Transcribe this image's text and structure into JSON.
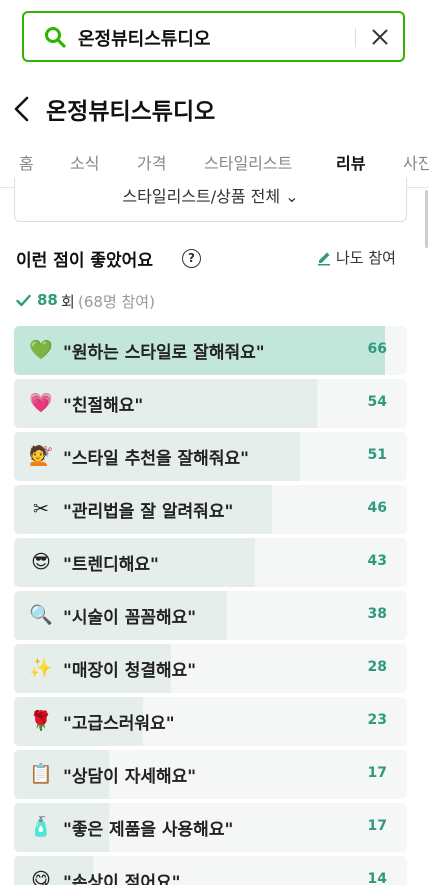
{
  "search": {
    "query": "온정뷰티스튜디오"
  },
  "header": {
    "title": "온정뷰티스튜디오"
  },
  "tabs": [
    {
      "label": "홈"
    },
    {
      "label": "소식"
    },
    {
      "label": "가격"
    },
    {
      "label": "스타일리스트"
    },
    {
      "label": "리뷰"
    },
    {
      "label": "사진"
    }
  ],
  "active_tab": "리뷰",
  "filter": {
    "label": "스타일리스트/상품 전체 ⌄"
  },
  "reviews": {
    "section_title": "이런 점이 좋았어요",
    "help_label": "?",
    "join_label": "나도 참여",
    "total_count": "88",
    "count_unit": "회",
    "participants": "(68명 참여)",
    "keywords": [
      {
        "emoji": "💚",
        "text": "\"원하는 스타일로 잘해줘요\"",
        "count": 66,
        "icon": "green-heart-icon"
      },
      {
        "emoji": "💗",
        "text": "\"친절해요\"",
        "count": 54,
        "icon": "pink-heart-icon"
      },
      {
        "emoji": "💇",
        "text": "\"스타일 추천을 잘해줘요\"",
        "count": 51,
        "icon": "haircut-icon"
      },
      {
        "emoji": "✂",
        "text": "\"관리법을 잘 알려줘요\"",
        "count": 46,
        "icon": "hair-dryer-icon"
      },
      {
        "emoji": "😎",
        "text": "\"트렌디해요\"",
        "count": 43,
        "icon": "sunglasses-face-icon"
      },
      {
        "emoji": "🔍",
        "text": "\"시술이 꼼꼼해요\"",
        "count": 38,
        "icon": "magnifier-icon"
      },
      {
        "emoji": "✨",
        "text": "\"매장이 청결해요\"",
        "count": 28,
        "icon": "sparkles-icon"
      },
      {
        "emoji": "🌹",
        "text": "\"고급스러워요\"",
        "count": 23,
        "icon": "rose-icon"
      },
      {
        "emoji": "📋",
        "text": "\"상담이 자세해요\"",
        "count": 17,
        "icon": "clipboard-icon"
      },
      {
        "emoji": "🧴",
        "text": "\"좋은 제품을 사용해요\"",
        "count": 17,
        "icon": "lotion-bottle-icon"
      },
      {
        "emoji": "😋",
        "text": "\"손상이 적어요\"",
        "count": 14,
        "icon": "face-icon"
      }
    ]
  },
  "colors": {
    "brand": "#2db400",
    "accent": "#2f9a7e",
    "bar_top": "#c3e6da",
    "bar": "#e6eeeb",
    "row_bg": "#f4f7f6"
  }
}
